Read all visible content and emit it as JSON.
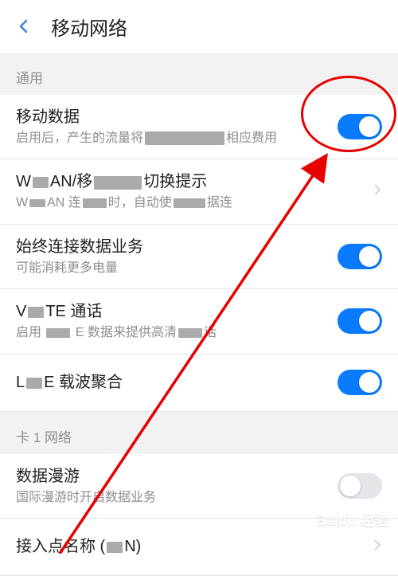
{
  "header": {
    "title": "移动网络"
  },
  "sections": {
    "general": {
      "label": "通用",
      "mobileData": {
        "title": "移动数据",
        "desc_pre": "启用后，产生的流量将",
        "desc_post": "相应费用"
      },
      "wlanSwitch": {
        "title_pre": "W",
        "title_mid": "AN/移",
        "title_post": "切换提示",
        "desc_pre": "W",
        "desc_mid1": "AN 连",
        "desc_mid2": "时，自动使",
        "desc_post": "据连"
      },
      "alwaysData": {
        "title": "始终连接数据业务",
        "desc": "可能消耗更多电量"
      },
      "volte": {
        "title_pre": "V",
        "title_post": "TE 通话",
        "desc_pre": "启用",
        "desc_mid": "E 数据来提供高清",
        "desc_post": "话"
      },
      "carrier": {
        "title_pre": "L",
        "title_post": "E 载波聚合"
      }
    },
    "sim1": {
      "label": "卡 1 网络",
      "roaming": {
        "title": "数据漫游",
        "desc": "国际漫游时开启数据业务"
      },
      "apn": {
        "title_pre": "接入点名称 (",
        "title_post": "N)"
      }
    }
  },
  "watermark": "Baidu 经验"
}
